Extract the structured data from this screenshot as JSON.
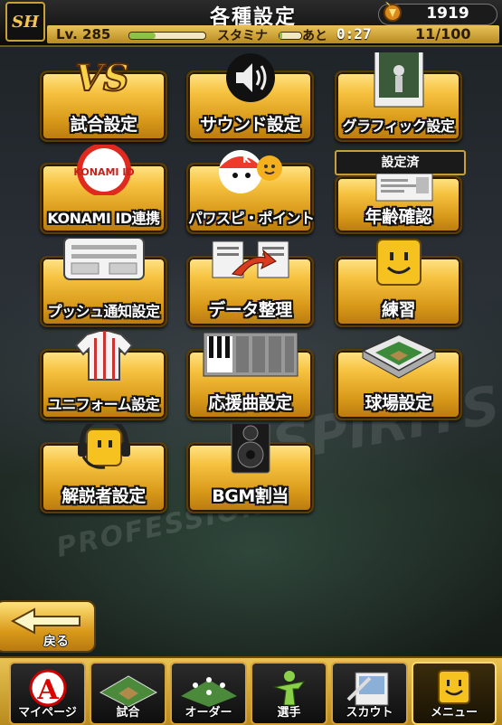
{
  "header": {
    "title": "各種設定",
    "logo_text": "SH",
    "coins": "1919",
    "level": "Lv. 285",
    "stamina_label": "スタミナ",
    "remaining_label": "あと",
    "timer": "0:27",
    "stamina_value": "11/100",
    "xp_progress": 0.35,
    "stamina_progress": 0.11
  },
  "settings_grid": [
    {
      "label": "試合設定",
      "icon": "vs-icon"
    },
    {
      "label": "サウンド設定",
      "icon": "speaker-icon"
    },
    {
      "label": "グラフィック設定",
      "icon": "graphics-icon"
    },
    {
      "label": "KONAMI ID連携",
      "icon": "konami-id-icon",
      "icon_text": "KONAMI ID"
    },
    {
      "label": "パワスピ・ポイント",
      "icon": "mascot-icon"
    },
    {
      "label": "年齢確認",
      "icon": "document-icon",
      "badge": "設定済"
    },
    {
      "label": "プッシュ通知設定",
      "icon": "notification-icon"
    },
    {
      "label": "データ整理",
      "icon": "data-transfer-icon"
    },
    {
      "label": "練習",
      "icon": "smiley-block-icon"
    },
    {
      "label": "ユニフォーム設定",
      "icon": "uniform-icon"
    },
    {
      "label": "応援曲設定",
      "icon": "piano-keys-icon"
    },
    {
      "label": "球場設定",
      "icon": "stadium-icon"
    },
    {
      "label": "解説者設定",
      "icon": "headset-icon"
    },
    {
      "label": "BGM割当",
      "icon": "loudspeaker-icon"
    }
  ],
  "back_button": {
    "label": "戻る"
  },
  "footer_nav": [
    {
      "label": "マイページ",
      "icon": "a-logo-icon"
    },
    {
      "label": "試合",
      "icon": "field-icon"
    },
    {
      "label": "オーダー",
      "icon": "lineup-icon"
    },
    {
      "label": "選手",
      "icon": "player-icon"
    },
    {
      "label": "スカウト",
      "icon": "scout-icon"
    },
    {
      "label": "メニュー",
      "icon": "menu-icon",
      "active": true
    }
  ],
  "colors": {
    "gold": "#f6c23f",
    "dark_frame": "#5a3c08",
    "xp_green": "#8ac442"
  }
}
